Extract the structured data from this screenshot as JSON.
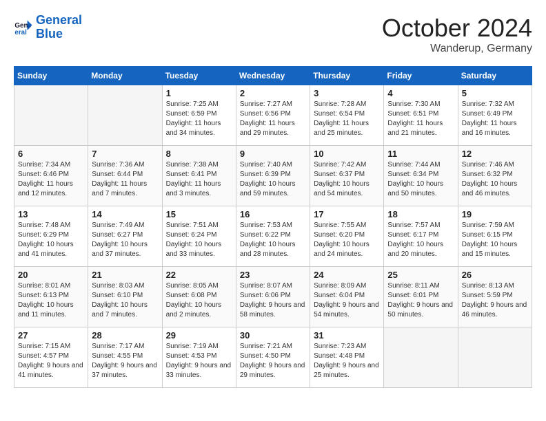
{
  "logo": {
    "line1": "General",
    "line2": "Blue"
  },
  "title": "October 2024",
  "location": "Wanderup, Germany",
  "weekdays": [
    "Sunday",
    "Monday",
    "Tuesday",
    "Wednesday",
    "Thursday",
    "Friday",
    "Saturday"
  ],
  "weeks": [
    [
      {
        "day": "",
        "empty": true
      },
      {
        "day": "",
        "empty": true
      },
      {
        "day": "1",
        "sunrise": "7:25 AM",
        "sunset": "6:59 PM",
        "daylight": "11 hours and 34 minutes."
      },
      {
        "day": "2",
        "sunrise": "7:27 AM",
        "sunset": "6:56 PM",
        "daylight": "11 hours and 29 minutes."
      },
      {
        "day": "3",
        "sunrise": "7:28 AM",
        "sunset": "6:54 PM",
        "daylight": "11 hours and 25 minutes."
      },
      {
        "day": "4",
        "sunrise": "7:30 AM",
        "sunset": "6:51 PM",
        "daylight": "11 hours and 21 minutes."
      },
      {
        "day": "5",
        "sunrise": "7:32 AM",
        "sunset": "6:49 PM",
        "daylight": "11 hours and 16 minutes."
      }
    ],
    [
      {
        "day": "6",
        "sunrise": "7:34 AM",
        "sunset": "6:46 PM",
        "daylight": "11 hours and 12 minutes."
      },
      {
        "day": "7",
        "sunrise": "7:36 AM",
        "sunset": "6:44 PM",
        "daylight": "11 hours and 7 minutes."
      },
      {
        "day": "8",
        "sunrise": "7:38 AM",
        "sunset": "6:41 PM",
        "daylight": "11 hours and 3 minutes."
      },
      {
        "day": "9",
        "sunrise": "7:40 AM",
        "sunset": "6:39 PM",
        "daylight": "10 hours and 59 minutes."
      },
      {
        "day": "10",
        "sunrise": "7:42 AM",
        "sunset": "6:37 PM",
        "daylight": "10 hours and 54 minutes."
      },
      {
        "day": "11",
        "sunrise": "7:44 AM",
        "sunset": "6:34 PM",
        "daylight": "10 hours and 50 minutes."
      },
      {
        "day": "12",
        "sunrise": "7:46 AM",
        "sunset": "6:32 PM",
        "daylight": "10 hours and 46 minutes."
      }
    ],
    [
      {
        "day": "13",
        "sunrise": "7:48 AM",
        "sunset": "6:29 PM",
        "daylight": "10 hours and 41 minutes."
      },
      {
        "day": "14",
        "sunrise": "7:49 AM",
        "sunset": "6:27 PM",
        "daylight": "10 hours and 37 minutes."
      },
      {
        "day": "15",
        "sunrise": "7:51 AM",
        "sunset": "6:24 PM",
        "daylight": "10 hours and 33 minutes."
      },
      {
        "day": "16",
        "sunrise": "7:53 AM",
        "sunset": "6:22 PM",
        "daylight": "10 hours and 28 minutes."
      },
      {
        "day": "17",
        "sunrise": "7:55 AM",
        "sunset": "6:20 PM",
        "daylight": "10 hours and 24 minutes."
      },
      {
        "day": "18",
        "sunrise": "7:57 AM",
        "sunset": "6:17 PM",
        "daylight": "10 hours and 20 minutes."
      },
      {
        "day": "19",
        "sunrise": "7:59 AM",
        "sunset": "6:15 PM",
        "daylight": "10 hours and 15 minutes."
      }
    ],
    [
      {
        "day": "20",
        "sunrise": "8:01 AM",
        "sunset": "6:13 PM",
        "daylight": "10 hours and 11 minutes."
      },
      {
        "day": "21",
        "sunrise": "8:03 AM",
        "sunset": "6:10 PM",
        "daylight": "10 hours and 7 minutes."
      },
      {
        "day": "22",
        "sunrise": "8:05 AM",
        "sunset": "6:08 PM",
        "daylight": "10 hours and 2 minutes."
      },
      {
        "day": "23",
        "sunrise": "8:07 AM",
        "sunset": "6:06 PM",
        "daylight": "9 hours and 58 minutes."
      },
      {
        "day": "24",
        "sunrise": "8:09 AM",
        "sunset": "6:04 PM",
        "daylight": "9 hours and 54 minutes."
      },
      {
        "day": "25",
        "sunrise": "8:11 AM",
        "sunset": "6:01 PM",
        "daylight": "9 hours and 50 minutes."
      },
      {
        "day": "26",
        "sunrise": "8:13 AM",
        "sunset": "5:59 PM",
        "daylight": "9 hours and 46 minutes."
      }
    ],
    [
      {
        "day": "27",
        "sunrise": "7:15 AM",
        "sunset": "4:57 PM",
        "daylight": "9 hours and 41 minutes."
      },
      {
        "day": "28",
        "sunrise": "7:17 AM",
        "sunset": "4:55 PM",
        "daylight": "9 hours and 37 minutes."
      },
      {
        "day": "29",
        "sunrise": "7:19 AM",
        "sunset": "4:53 PM",
        "daylight": "9 hours and 33 minutes."
      },
      {
        "day": "30",
        "sunrise": "7:21 AM",
        "sunset": "4:50 PM",
        "daylight": "9 hours and 29 minutes."
      },
      {
        "day": "31",
        "sunrise": "7:23 AM",
        "sunset": "4:48 PM",
        "daylight": "9 hours and 25 minutes."
      },
      {
        "day": "",
        "empty": true
      },
      {
        "day": "",
        "empty": true
      }
    ]
  ],
  "labels": {
    "sunrise": "Sunrise:",
    "sunset": "Sunset:",
    "daylight": "Daylight:"
  }
}
